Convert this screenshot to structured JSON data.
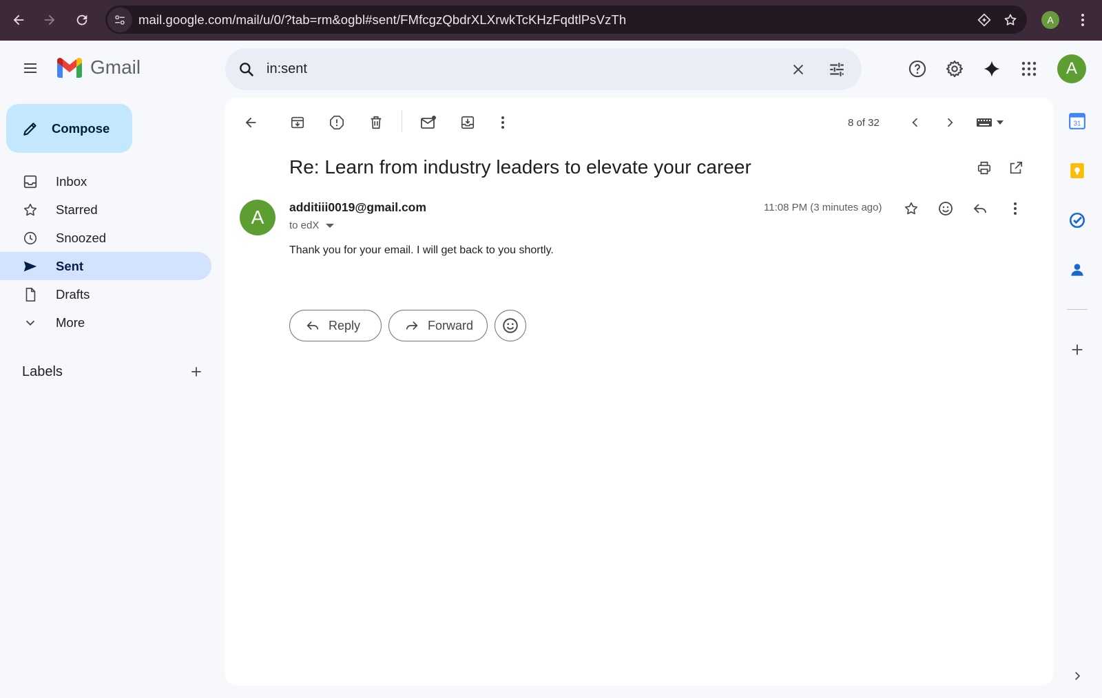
{
  "browser": {
    "url": "mail.google.com/mail/u/0/?tab=rm&ogbl#sent/FMfcgzQbdrXLXrwkTcKHzFqdtlPsVzTh",
    "profile_initial": "A"
  },
  "header": {
    "app_name": "Gmail",
    "search_value": "in:sent",
    "avatar_initial": "A"
  },
  "sidebar": {
    "compose_label": "Compose",
    "items": [
      {
        "label": "Inbox",
        "icon": "inbox-icon"
      },
      {
        "label": "Starred",
        "icon": "star-icon"
      },
      {
        "label": "Snoozed",
        "icon": "clock-icon"
      },
      {
        "label": "Sent",
        "icon": "send-icon",
        "active": true
      },
      {
        "label": "Drafts",
        "icon": "draft-icon"
      },
      {
        "label": "More",
        "icon": "chevron-down-icon"
      }
    ],
    "labels_title": "Labels"
  },
  "toolbar": {
    "pager": "8 of 32"
  },
  "email": {
    "subject": "Re: Learn from industry leaders to elevate your career",
    "sender": "additiii0019@gmail.com",
    "sender_initial": "A",
    "recipient": "to edX",
    "timestamp": "11:08 PM (3 minutes ago)",
    "body": "Thank you for your email. I will get back to you shortly.",
    "reply_label": "Reply",
    "forward_label": "Forward"
  },
  "colors": {
    "accent": "#c2e7ff",
    "active_nav": "#d3e3fd",
    "avatar": "#5c9e31",
    "chrome": "#3c2a3a"
  }
}
